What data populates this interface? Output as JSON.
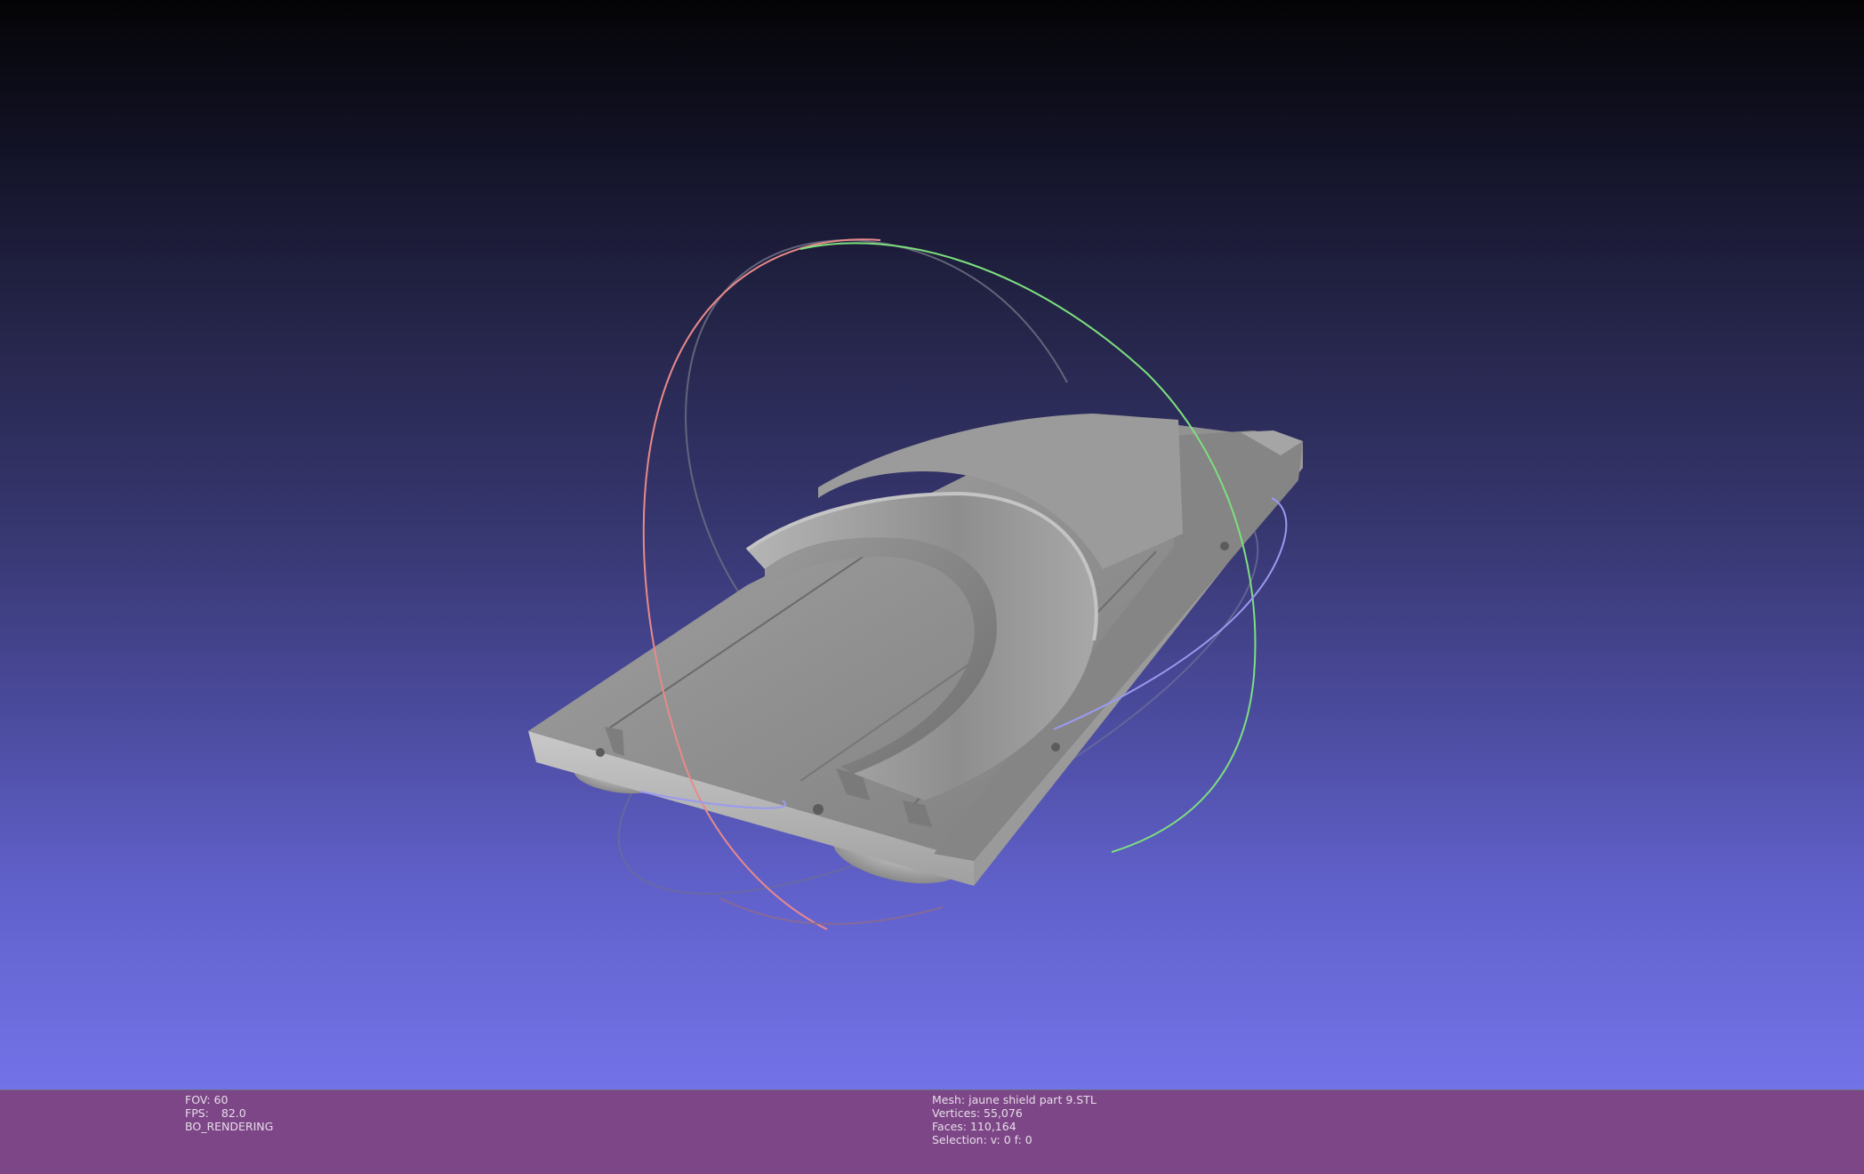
{
  "viewport": {
    "name": "3d-viewport",
    "trackball": {
      "ring_colors": {
        "x_ring": "#e88a8a",
        "y_ring": "#7de07d",
        "z_ring": "#9a9af0"
      }
    },
    "mesh_color": "#8c8c8c",
    "background_top": "#040406",
    "background_bottom": "#7373e8"
  },
  "info": {
    "fov_label": "FOV:",
    "fov_value": "60",
    "fps_label": "FPS:",
    "fps_value": "82.0",
    "render_mode": "BO_RENDERING",
    "mesh_line": "Mesh: jaune shield part 9.STL",
    "vertices_line": "Vertices: 55,076",
    "faces_line": "Faces: 110,164",
    "selection_line": "Selection: v: 0 f: 0"
  },
  "colors": {
    "info_bar_bg": "#7d4686",
    "info_text": "#e6dcea"
  }
}
